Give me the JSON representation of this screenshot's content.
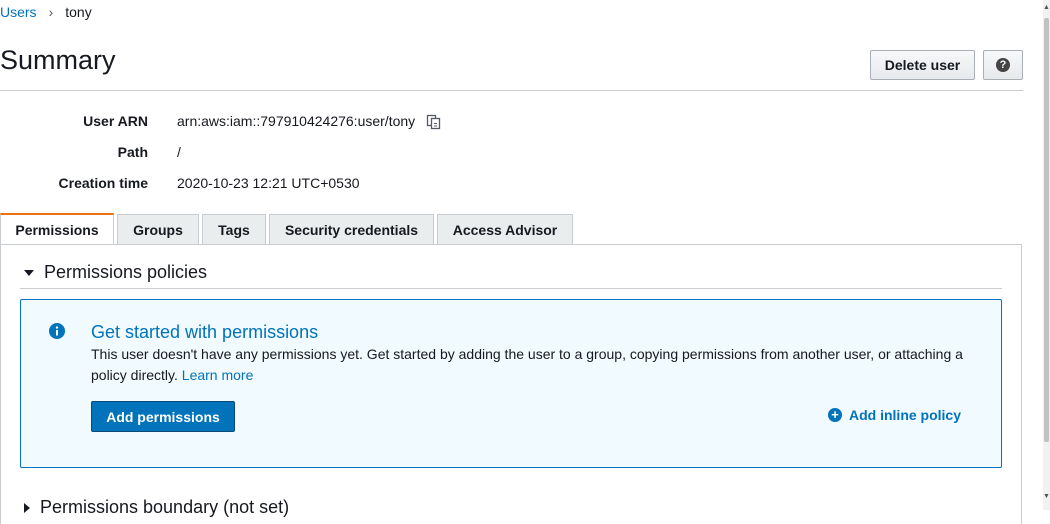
{
  "breadcrumb": {
    "parent": "Users",
    "separator": "›",
    "current": "tony"
  },
  "page": {
    "title": "Summary"
  },
  "actions": {
    "delete_label": "Delete user",
    "help_glyph": "?"
  },
  "summary": {
    "arn_label": "User ARN",
    "arn_value": "arn:aws:iam::797910424276:user/tony",
    "path_label": "Path",
    "path_value": "/",
    "created_label": "Creation time",
    "created_value": "2020-10-23 12:21 UTC+0530"
  },
  "tabs": [
    {
      "label": "Permissions",
      "active": true
    },
    {
      "label": "Groups"
    },
    {
      "label": "Tags"
    },
    {
      "label": "Security credentials"
    },
    {
      "label": "Access Advisor"
    }
  ],
  "permissions": {
    "section_title": "Permissions policies",
    "info_title": "Get started with permissions",
    "info_text": "This user doesn't have any permissions yet. Get started by adding the user to a group, copying permissions from another user, or attaching a policy directly.",
    "learn_more": "Learn more",
    "add_permissions": "Add permissions",
    "add_inline_policy": "Add inline policy",
    "next_section_title": "Permissions boundary (not set)"
  },
  "icons": {
    "copy": "copy-icon",
    "help": "help-icon",
    "info": "info-icon",
    "caret": "caret-down-icon",
    "plus": "plus-circle-icon"
  },
  "colors": {
    "link": "#0073bb",
    "primary": "#0073bb",
    "tab_accent": "#ec7211",
    "info_bg": "#f1faff"
  }
}
